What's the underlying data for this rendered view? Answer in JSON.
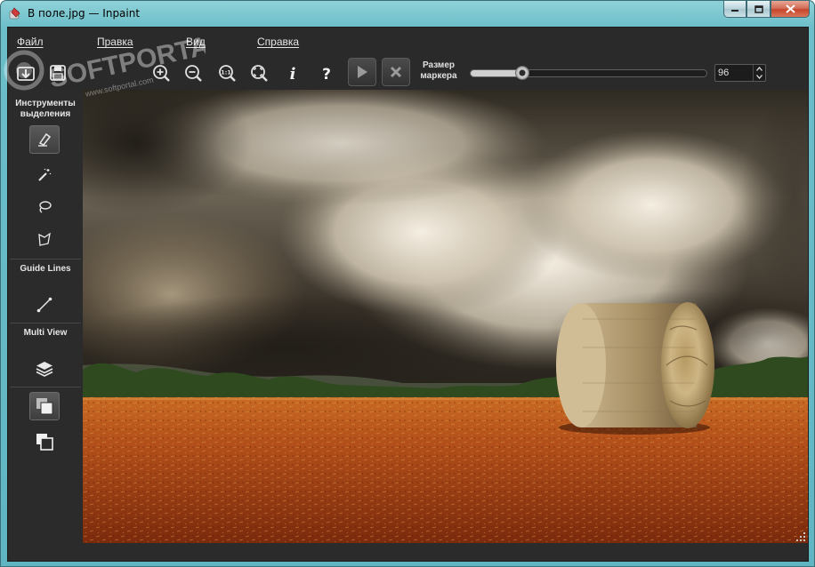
{
  "window": {
    "title": "В поле.jpg — Inpaint"
  },
  "menu": {
    "items": [
      "Файл",
      "Правка",
      "Вид",
      "Справка"
    ]
  },
  "toolbar": {
    "icons": [
      "open-icon",
      "save-icon",
      "zoom-in-icon",
      "zoom-out-icon",
      "actual-size-icon",
      "fit-icon",
      "info-icon",
      "help-icon",
      "run-icon",
      "cancel-icon"
    ],
    "marker_size_label": "Размер маркера",
    "marker_size_value": "96",
    "marker_size_fraction": 0.22
  },
  "leftpanel": {
    "selection_heading": "Инструменты выделения",
    "guide_heading": "Guide Lines",
    "multiview_heading": "Multi View",
    "tools": [
      "marker-icon",
      "magic-wand-icon",
      "lasso-icon",
      "polygon-lasso-icon",
      "guide-line-icon",
      "layers-icon",
      "copy-area-icon",
      "copy-area-outline-icon"
    ]
  },
  "watermark": {
    "text": "SOFTPORTAL",
    "url": "www.softportal.com"
  },
  "colors": {
    "window_frame": "#6cbec9",
    "panel_bg": "#2b2b2b",
    "close_button": "#c7452b"
  }
}
